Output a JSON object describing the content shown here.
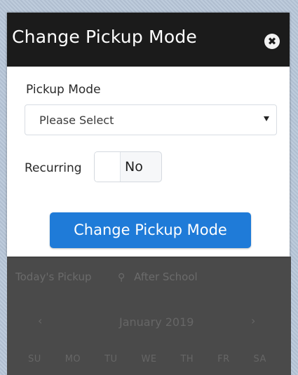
{
  "modal": {
    "title": "Change Pickup Mode",
    "close_icon_glyph": "✖",
    "pickup_mode_label": "Pickup Mode",
    "pickup_mode_select": {
      "selected_value": "Please Select"
    },
    "recurring_label": "Recurring",
    "recurring_toggle_state": "No",
    "submit_label": "Change Pickup Mode"
  },
  "background": {
    "todays_pickup_label": "Today's Pickup",
    "pickup_type": "After School",
    "pin_icon": "location-pin-icon",
    "calendar": {
      "prev_glyph": "‹",
      "month_label": "January 2019",
      "next_glyph": "›",
      "weekdays": [
        "SU",
        "MO",
        "TU",
        "WE",
        "TH",
        "FR",
        "SA"
      ]
    }
  },
  "colors": {
    "header_bg": "#1b1b1b",
    "primary_button": "#1f7bd8",
    "background_app": "#4a4a4a"
  }
}
